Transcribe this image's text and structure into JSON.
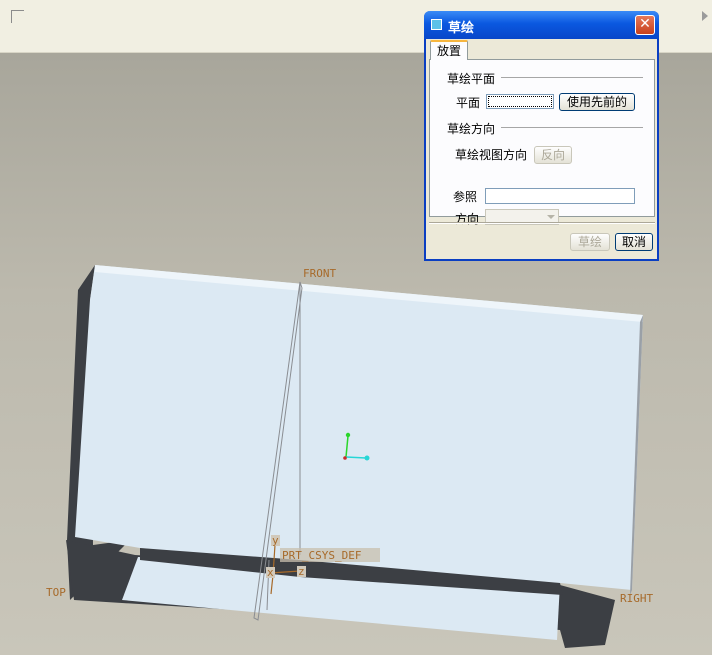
{
  "toolbar": {
    "corner_icon": "viewport-corner-icon",
    "overflow_icon": "chevron-right-icon"
  },
  "viewport": {
    "datum_labels": {
      "front": "FRONT",
      "top": "TOP",
      "right": "RIGHT",
      "csys": "PRT_CSYS_DEF"
    },
    "axis_letters": {
      "x": "x",
      "y": "y",
      "z": "z"
    },
    "colors": {
      "model_face": "#dce9f3",
      "model_edge": "#3c3f44",
      "datum_text": "#a76a2a"
    }
  },
  "dialog": {
    "title": "草绘",
    "close_icon": "close-icon",
    "tab": "放置",
    "plane_section": "草绘平面",
    "plane_label": "平面",
    "plane_value": "",
    "use_previous_button": "使用先前的",
    "orientation_section": "草绘方向",
    "view_direction_label": "草绘视图方向",
    "flip_button": "反向",
    "reference_label": "参照",
    "reference_value": "",
    "orientation_label": "方向",
    "orientation_value": "",
    "sketch_button": "草绘",
    "cancel_button": "取消"
  }
}
